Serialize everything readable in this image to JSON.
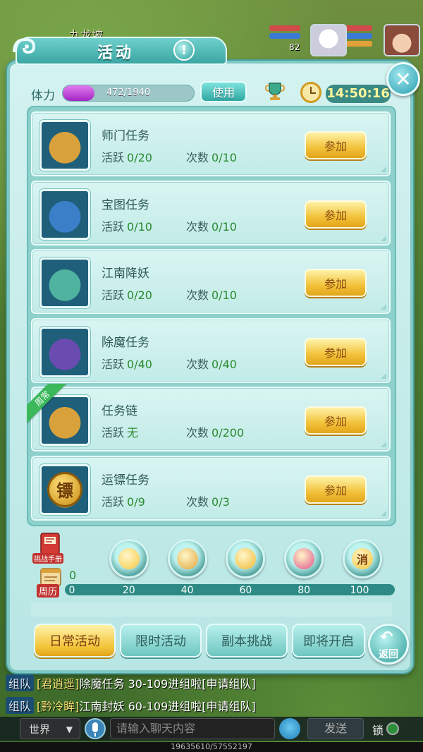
{
  "hud": {
    "map_name": "九龙坡",
    "party_level": "82"
  },
  "dialog": {
    "title": "活动",
    "info_label": "!",
    "close_label": "✕",
    "stamina": {
      "label": "体力",
      "current": 472,
      "max": 1940,
      "value_text": "472/1940",
      "fill_fraction": 0.243
    },
    "use_button": "使用",
    "clock_time": "14:50:16",
    "activity_prefix": "活跃",
    "count_prefix": "次数",
    "join_label": "参加",
    "activities": [
      {
        "name": "师门任务",
        "active": "0/20",
        "count": "0/10",
        "icon": "master-portrait-icon",
        "color": "#d9a13b"
      },
      {
        "name": "宝图任务",
        "active": "0/10",
        "count": "0/10",
        "icon": "ninja-portrait-icon",
        "color": "#3a7fc8"
      },
      {
        "name": "江南降妖",
        "active": "0/20",
        "count": "0/10",
        "icon": "demon-portrait-icon",
        "color": "#4fb3a0"
      },
      {
        "name": "除魔任务",
        "active": "0/40",
        "count": "0/40",
        "icon": "jiangshi-portrait-icon",
        "color": "#6a4bb0"
      },
      {
        "name": "任务链",
        "active": "无",
        "count": "0/200",
        "icon": "book-icon",
        "color": "#d9a13b",
        "badge": "周常"
      },
      {
        "name": "运镖任务",
        "active": "0/9",
        "count": "0/3",
        "icon": "escort-coin-icon",
        "color": "#d9a13b",
        "coin_char": "镖"
      }
    ],
    "reward": {
      "handbook_label": "挑战手册",
      "calendar_label": "周历",
      "current_score": "0",
      "progress_fraction": 0,
      "ticks": [
        "0",
        "20",
        "40",
        "60",
        "80",
        "100"
      ],
      "orbs": [
        {
          "name": "reward-20-orb",
          "color": "#f5c842"
        },
        {
          "name": "reward-40-orb",
          "color": "#e0a43a"
        },
        {
          "name": "reward-60-orb",
          "color": "#f0b833"
        },
        {
          "name": "reward-80-orb",
          "color": "#e0508a"
        },
        {
          "name": "reward-100-orb",
          "color": "#f2c23a"
        }
      ],
      "coin_char": "消"
    },
    "tabs": [
      "日常活动",
      "限时活动",
      "副本挑战",
      "即将开启"
    ],
    "active_tab": 0,
    "back_label": "返回"
  },
  "chat": {
    "lines": [
      {
        "channel": "组队",
        "player": "[君逍遥]",
        "message": "除魔任务 30-109进组啦[申请组队]"
      },
      {
        "channel": "组队",
        "player": "[黔冷眸]",
        "message": "江南封妖 60-109进组啦[申请组队]"
      }
    ],
    "channel_select": "世界",
    "input_placeholder": "请输入聊天内容",
    "send_label": "发送",
    "lock_label": "锁",
    "exp_text": "19635610/57552197"
  }
}
